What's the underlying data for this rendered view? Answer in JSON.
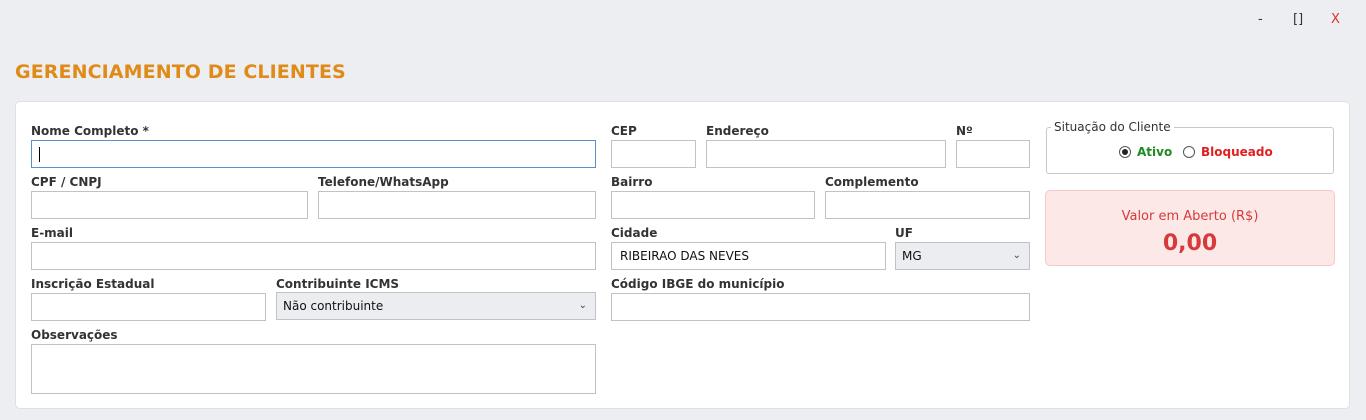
{
  "window_controls": {
    "minimize": "-",
    "maximize": "[]",
    "close": "X"
  },
  "page_title": "GERENCIAMENTO DE CLIENTES",
  "form": {
    "nome_label": "Nome Completo *",
    "nome_value": "",
    "cpf_label": "CPF / CNPJ",
    "cpf_value": "",
    "telefone_label": "Telefone/WhatsApp",
    "telefone_value": "",
    "email_label": "E-mail",
    "email_value": "",
    "ie_label": "Inscrição Estadual",
    "ie_value": "",
    "icms_label": "Contribuinte ICMS",
    "icms_value": "Não contribuinte",
    "obs_label": "Observações",
    "obs_value": "",
    "cep_label": "CEP",
    "cep_value": "",
    "endereco_label": "Endereço",
    "endereco_value": "",
    "numero_label": "Nº",
    "numero_value": "",
    "bairro_label": "Bairro",
    "bairro_value": "",
    "complemento_label": "Complemento",
    "complemento_value": "",
    "cidade_label": "Cidade",
    "cidade_value": "RIBEIRAO DAS NEVES",
    "uf_label": "UF",
    "uf_value": "MG",
    "ibge_label": "Código IBGE do município",
    "ibge_value": ""
  },
  "status": {
    "title": "Situação do Cliente",
    "ativo_label": "Ativo",
    "bloqueado_label": "Bloqueado",
    "selected": "Ativo",
    "ativo_color": "#1f8a1f",
    "bloqueado_color": "#e02020"
  },
  "balance": {
    "label": "Valor em Aberto (R$)",
    "value": "0,00",
    "color": "#d63a3a"
  }
}
